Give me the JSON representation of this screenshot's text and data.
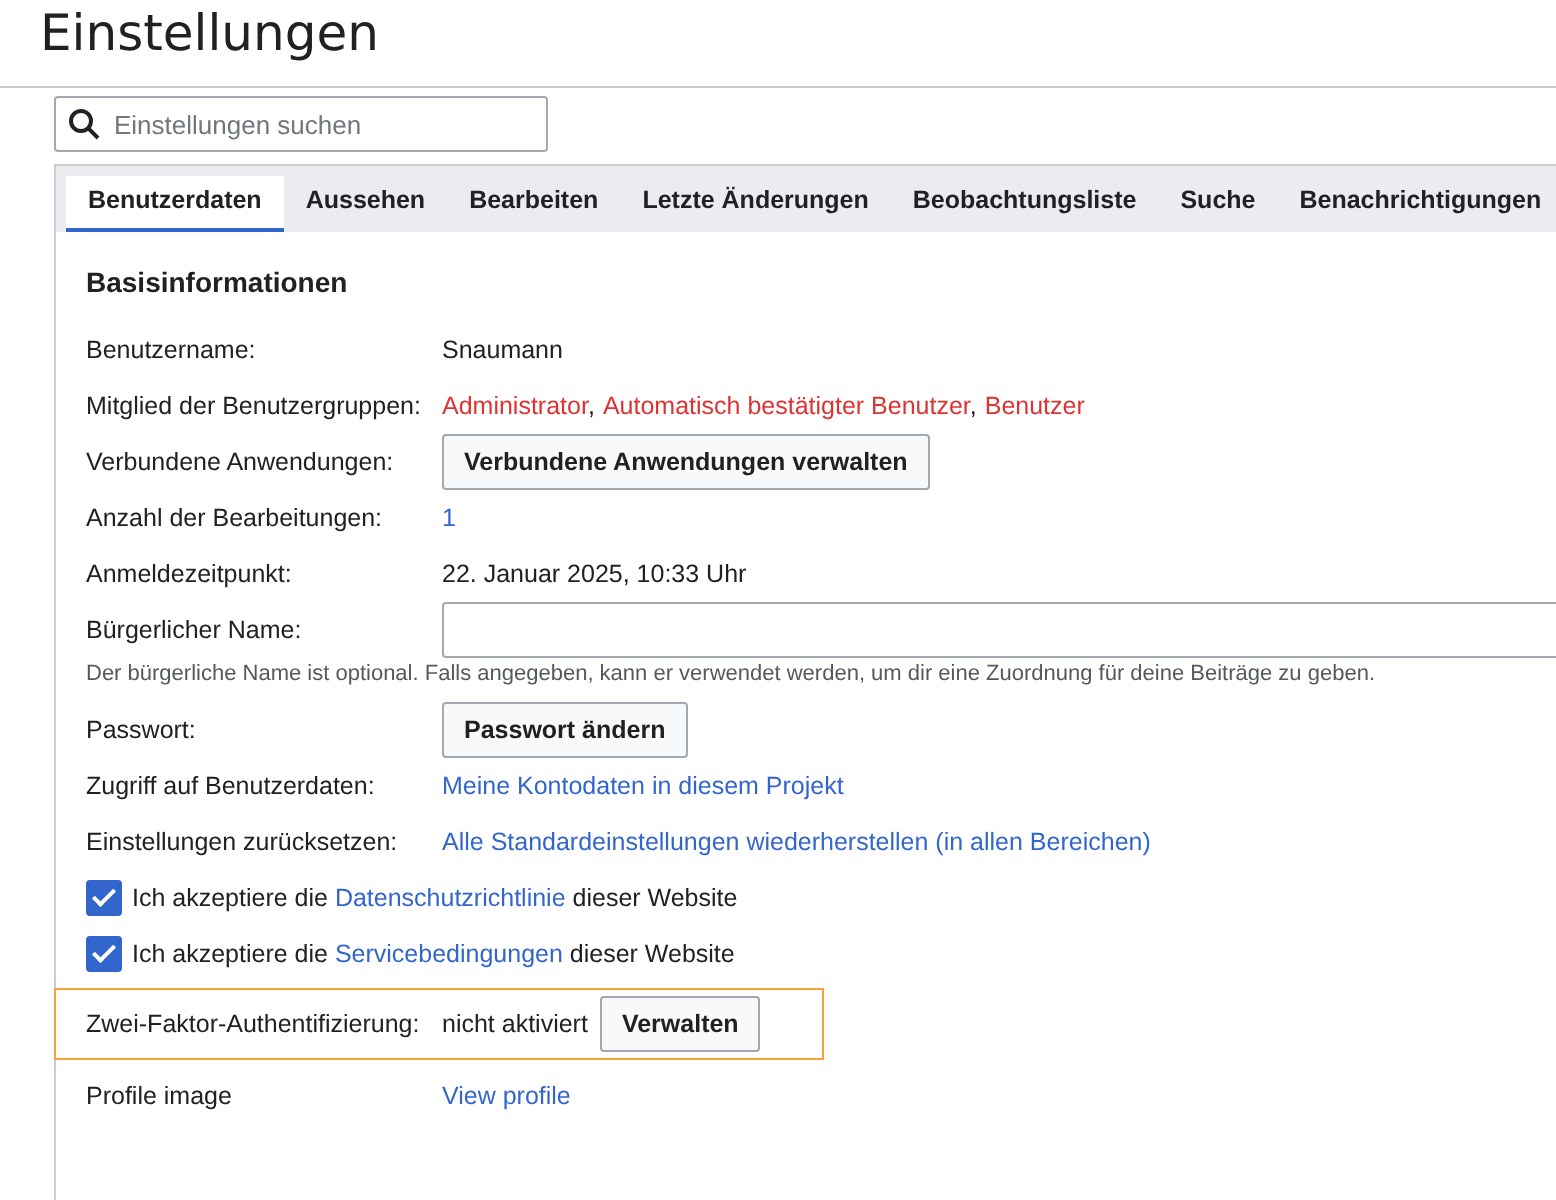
{
  "title": "Einstellungen",
  "search": {
    "placeholder": "Einstellungen suchen"
  },
  "tabs": [
    {
      "label": "Benutzerdaten",
      "selected": true
    },
    {
      "label": "Aussehen",
      "selected": false
    },
    {
      "label": "Bearbeiten",
      "selected": false
    },
    {
      "label": "Letzte Änderungen",
      "selected": false
    },
    {
      "label": "Beobachtungsliste",
      "selected": false
    },
    {
      "label": "Suche",
      "selected": false
    },
    {
      "label": "Benachrichtigungen",
      "selected": false
    }
  ],
  "section_title": "Basisinformationen",
  "rows": [
    {
      "kind": "text",
      "highlighted": false,
      "label": "Benutzername:",
      "value": "Snaumann"
    },
    {
      "kind": "groups",
      "highlighted": false,
      "label": "Mitglied der Benutzergruppen:",
      "separator": ",",
      "groups": [
        "Administrator",
        "Automatisch bestätigter Benutzer",
        "Benutzer"
      ]
    },
    {
      "kind": "button",
      "highlighted": false,
      "label": "Verbundene Anwendungen:",
      "button": "Verbundene Anwendungen verwalten"
    },
    {
      "kind": "link",
      "highlighted": false,
      "label": "Anzahl der Bearbeitungen:",
      "link": "1"
    },
    {
      "kind": "text",
      "highlighted": false,
      "label": "Anmeldezeitpunkt:",
      "value": "22. Januar 2025, 10:33 Uhr"
    },
    {
      "kind": "input",
      "highlighted": false,
      "label": "Bürgerlicher Name:",
      "help": "Der bürgerliche Name ist optional. Falls angegeben, kann er verwendet werden, um dir eine Zuordnung für deine Beiträge zu geben."
    },
    {
      "kind": "button",
      "highlighted": false,
      "label": "Passwort:",
      "button": "Passwort ändern"
    },
    {
      "kind": "link",
      "highlighted": false,
      "label": "Zugriff auf Benutzerdaten:",
      "link": "Meine Kontodaten in diesem Projekt"
    },
    {
      "kind": "link",
      "highlighted": false,
      "label": "Einstellungen zurücksetzen:",
      "link": "Alle Standardeinstellungen wiederherstellen (in allen Bereichen)"
    },
    {
      "kind": "checkbox",
      "highlighted": false,
      "checked": true,
      "before": "Ich akzeptiere die",
      "link": "Datenschutzrichtlinie",
      "after": "dieser Website"
    },
    {
      "kind": "checkbox",
      "highlighted": false,
      "checked": true,
      "before": "Ich akzeptiere die",
      "link": "Servicebedingungen",
      "after": "dieser Website"
    },
    {
      "kind": "status_button",
      "highlighted": true,
      "label": "Zwei-Faktor-Authentifizierung:",
      "value": "nicht aktiviert",
      "button": "Verwalten"
    },
    {
      "kind": "link",
      "highlighted": false,
      "label": "Profile image",
      "link": "View profile"
    }
  ]
}
